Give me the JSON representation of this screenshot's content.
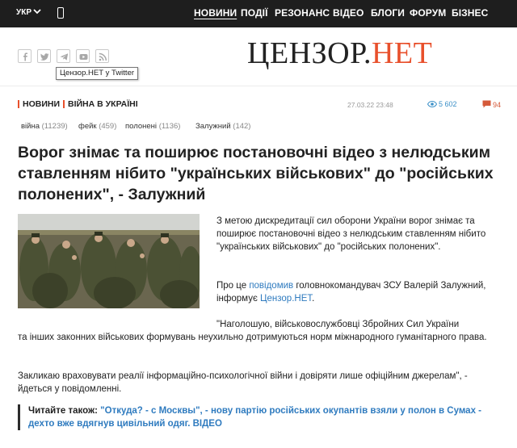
{
  "topbar": {
    "language": "УКР",
    "nav": [
      "НОВИНИ",
      "ПОДІЇ",
      "РЕЗОНАНС",
      "ВІДЕО",
      "БЛОГИ",
      "ФОРУМ",
      "БІЗНЕС"
    ]
  },
  "header": {
    "logo_part1": "ЦЕНЗОР.",
    "logo_part2": "НЕТ",
    "tooltip": "Цензор.НЕТ у Twitter",
    "colors": {
      "accent": "#e8502c",
      "link": "#2f7bbf",
      "topbar": "#1e1e1e"
    }
  },
  "breadcrumb": [
    "НОВИНИ",
    "ВІЙНА В УКРАЇНІ"
  ],
  "meta": {
    "date": "27.03.22 23:48",
    "views": "5 602",
    "comments": "94"
  },
  "tags": [
    {
      "name": "війна",
      "count": "(11239)"
    },
    {
      "name": "фейк",
      "count": "(459)"
    },
    {
      "name": "полонені",
      "count": "(1136)"
    },
    {
      "name": "Залужний",
      "count": "(142)"
    }
  ],
  "article": {
    "title": "Ворог знімає та поширює постановочні відео з нелюдським ставленням нібито \"українських військових\" до \"російських полонених\", - Залужний",
    "p1": "З метою дискредитації сил оборони України ворог знімає та поширює постановочні відео з нелюдським ставленням нібито \"українських військових\" до \"російських полонених\".",
    "p2_before": "Про це ",
    "p2_link1": "повідомив",
    "p2_middle": " головнокомандувач ЗСУ Валерій Залужний, інформує ",
    "p2_link2": "Цензор.НЕТ",
    "p2_after": ".",
    "p3_line1": "\"Наголошую, військовослужбовці Збройних Сил України",
    "p3_rest": "та інших законних військових формувань неухильно дотримуються норм міжнародного гуманітарного права.",
    "p4": "Закликаю враховувати реалії інформаційно-психологічної війни і довіряти лише офіційним джерелам\", - йдеться у повідомленні.",
    "read_also_label": "Читайте також:",
    "read_also_link": "\"Откуда? - с Москвы\", - нову партію російських окупантів взяли у полон в Сумах - дехто вже вдягнув цивільний одяг. ВІДЕО"
  }
}
